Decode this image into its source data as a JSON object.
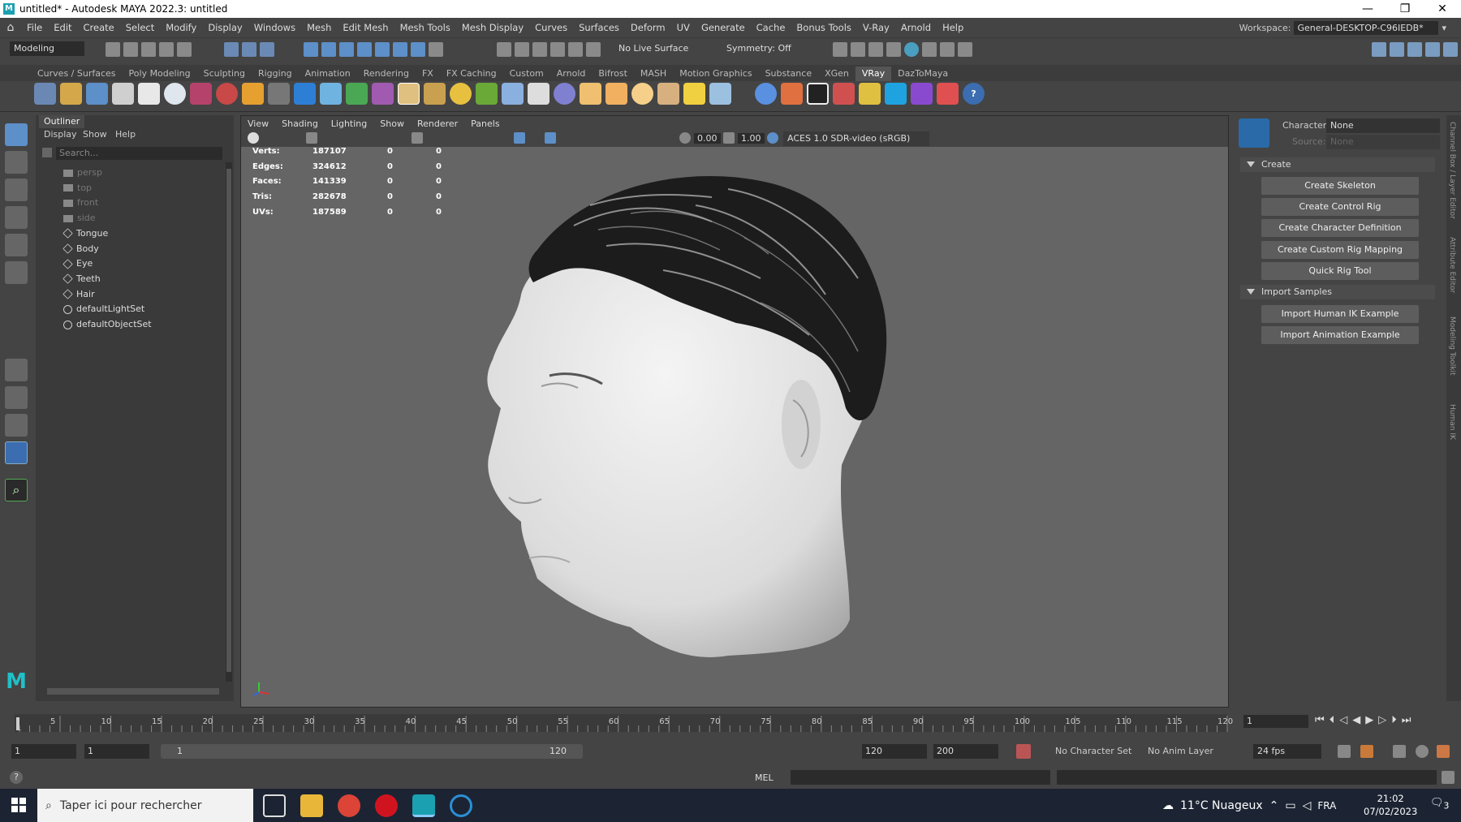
{
  "window": {
    "title": "untitled* - Autodesk MAYA 2022.3: untitled",
    "minimize": "—",
    "maximize": "❐",
    "close": "✕"
  },
  "menubar": {
    "items": [
      "File",
      "Edit",
      "Create",
      "Select",
      "Modify",
      "Display",
      "Windows",
      "Mesh",
      "Edit Mesh",
      "Mesh Tools",
      "Mesh Display",
      "Curves",
      "Surfaces",
      "Deform",
      "UV",
      "Generate",
      "Cache",
      "Bonus Tools",
      "V-Ray",
      "Arnold",
      "Help"
    ]
  },
  "workspace": {
    "label": "Workspace:",
    "value": "General-DESKTOP-C96IEDB*"
  },
  "statusline": {
    "menuset": "Modeling",
    "live_surface": "No Live Surface",
    "symmetry": "Symmetry: Off"
  },
  "shelf_tabs": [
    "Curves / Surfaces",
    "Poly Modeling",
    "Sculpting",
    "Rigging",
    "Animation",
    "Rendering",
    "FX",
    "FX Caching",
    "Custom",
    "Arnold",
    "Bifrost",
    "MASH",
    "Motion Graphics",
    "Substance",
    "XGen",
    "VRay",
    "DazToMaya"
  ],
  "shelf_active": "VRay",
  "outliner": {
    "title": "Outliner",
    "menu": [
      "Display",
      "Show",
      "Help"
    ],
    "search_placeholder": "Search...",
    "items": [
      {
        "label": "persp",
        "kind": "camera"
      },
      {
        "label": "top",
        "kind": "camera"
      },
      {
        "label": "front",
        "kind": "camera"
      },
      {
        "label": "side",
        "kind": "camera"
      },
      {
        "label": "Tongue",
        "kind": "mesh"
      },
      {
        "label": "Body",
        "kind": "mesh"
      },
      {
        "label": "Eye",
        "kind": "mesh"
      },
      {
        "label": "Teeth",
        "kind": "mesh"
      },
      {
        "label": "Hair",
        "kind": "mesh"
      },
      {
        "label": "defaultLightSet",
        "kind": "set"
      },
      {
        "label": "defaultObjectSet",
        "kind": "set"
      }
    ]
  },
  "viewport": {
    "menu": [
      "View",
      "Shading",
      "Lighting",
      "Show",
      "Renderer",
      "Panels"
    ],
    "exposure": "0.00",
    "gamma": "1.00",
    "colorspace": "ACES 1.0 SDR-video (sRGB)",
    "hud": [
      {
        "label": "Verts:",
        "value": "187107",
        "a": "0",
        "b": "0"
      },
      {
        "label": "Edges:",
        "value": "324612",
        "a": "0",
        "b": "0"
      },
      {
        "label": "Faces:",
        "value": "141339",
        "a": "0",
        "b": "0"
      },
      {
        "label": "Tris:",
        "value": "282678",
        "a": "0",
        "b": "0"
      },
      {
        "label": "UVs:",
        "value": "187589",
        "a": "0",
        "b": "0"
      }
    ]
  },
  "hik": {
    "character_label": "Character:",
    "character_value": "None",
    "source_label": "Source:",
    "source_value": "None",
    "create_section": "Create",
    "create_buttons": [
      "Create Skeleton",
      "Create Control Rig",
      "Create Character Definition",
      "Create Custom Rig Mapping",
      "Quick Rig Tool"
    ],
    "import_section": "Import Samples",
    "import_buttons": [
      "Import Human IK Example",
      "Import Animation Example"
    ]
  },
  "side_tabs": [
    "Channel Box / Layer Editor",
    "Attribute Editor",
    "Modeling Toolkit",
    "Human IK"
  ],
  "timeslider": {
    "ticks": [
      "5",
      "10",
      "15",
      "20",
      "25",
      "30",
      "35",
      "40",
      "45",
      "50",
      "55",
      "60",
      "65",
      "70",
      "75",
      "80",
      "85",
      "90",
      "95",
      "100",
      "105",
      "110",
      "115",
      "120"
    ],
    "first": "1",
    "current_frame": "1"
  },
  "rangeslider": {
    "start": "1",
    "playback_start": "1",
    "range_start": "1",
    "range_end": "120",
    "playback_end": "120",
    "end": "200",
    "character_set": "No Character Set",
    "anim_layer": "No Anim Layer",
    "fps": "24 fps"
  },
  "cmdline": {
    "lang": "MEL",
    "help": "?"
  },
  "taskbar": {
    "search_placeholder": "Taper ici pour rechercher",
    "weather": "11°C  Nuageux",
    "lang": "FRA",
    "time": "21:02",
    "date": "07/02/2023",
    "notif": "3"
  },
  "colors": {
    "accent": "#5d8fc9",
    "panel": "#444444",
    "viewport": "#656565",
    "field": "#2b2b2b"
  }
}
